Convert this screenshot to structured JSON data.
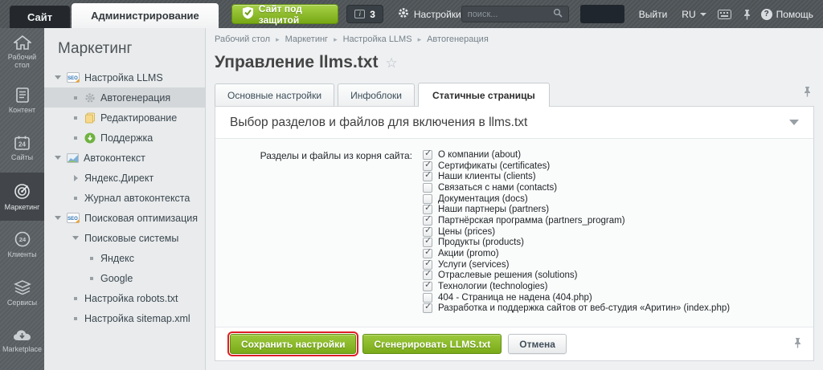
{
  "topbar": {
    "tabs": [
      {
        "label": "Сайт",
        "active": false
      },
      {
        "label": "Администрирование",
        "active": true
      }
    ],
    "protected_button": "Сайт под защитой",
    "protected_icon": "shield-check-icon",
    "notifications_count": "3",
    "notifications_icon": "info-bubble-icon",
    "settings_label": "Настройки",
    "settings_icon": "gear-icon",
    "search_placeholder": "поиск...",
    "search_icon": "magnifier-icon",
    "logout_label": "Выйти",
    "language": "RU",
    "keyboard_icon": "keyboard-icon",
    "pin_icon": "pin-icon",
    "help_label": "Помощь",
    "help_icon": "question-circle-icon"
  },
  "rail": {
    "items": [
      {
        "label": "Рабочий стол",
        "icon": "home-icon",
        "active": false
      },
      {
        "label": "Контент",
        "icon": "document-icon",
        "active": false
      },
      {
        "label": "Сайты",
        "icon": "calendar-24-icon",
        "active": false
      },
      {
        "label": "Маркетинг",
        "icon": "target-icon",
        "active": true
      },
      {
        "label": "Клиенты",
        "icon": "circle-24-icon",
        "active": false
      },
      {
        "label": "Сервисы",
        "icon": "layers-icon",
        "active": false
      },
      {
        "label": "Marketplace",
        "icon": "cloud-download-icon",
        "active": false
      }
    ]
  },
  "sidebar": {
    "title": "Маркетинг",
    "items": [
      {
        "label": "Настройка LLMS",
        "level": 0,
        "marker": "expanded",
        "icon": "seo-icon",
        "selected": false
      },
      {
        "label": "Автогенерация",
        "level": 1,
        "marker": "bullet",
        "icon": "gear-icon",
        "selected": true
      },
      {
        "label": "Редактирование",
        "level": 1,
        "marker": "bullet",
        "icon": "documents-icon",
        "selected": false
      },
      {
        "label": "Поддержка",
        "level": 1,
        "marker": "bullet",
        "icon": "update-circle-icon",
        "selected": false
      },
      {
        "label": "Автоконтекст",
        "level": 0,
        "marker": "expanded",
        "icon": "chart-icon",
        "selected": false
      },
      {
        "label": "Яндекс.Директ",
        "level": 1,
        "marker": "collapsed",
        "icon": "",
        "selected": false
      },
      {
        "label": "Журнал автоконтекста",
        "level": 1,
        "marker": "bullet",
        "icon": "",
        "selected": false
      },
      {
        "label": "Поисковая оптимизация",
        "level": 0,
        "marker": "expanded",
        "icon": "seo-icon",
        "selected": false
      },
      {
        "label": "Поисковые системы",
        "level": 1,
        "marker": "expanded",
        "icon": "",
        "selected": false
      },
      {
        "label": "Яндекс",
        "level": 2,
        "marker": "bullet",
        "icon": "",
        "selected": false
      },
      {
        "label": "Google",
        "level": 2,
        "marker": "bullet",
        "icon": "",
        "selected": false
      },
      {
        "label": "Настройка robots.txt",
        "level": 1,
        "marker": "bullet",
        "icon": "",
        "selected": false
      },
      {
        "label": "Настройка sitemap.xml",
        "level": 1,
        "marker": "bullet",
        "icon": "",
        "selected": false
      }
    ]
  },
  "breadcrumb": [
    "Рабочий стол",
    "Маркетинг",
    "Настройка LLMS",
    "Автогенерация"
  ],
  "page": {
    "title": "Управление llms.txt",
    "favorite_icon": "star-icon"
  },
  "tabs": [
    {
      "label": "Основные настройки",
      "active": false
    },
    {
      "label": "Инфоблоки",
      "active": false
    },
    {
      "label": "Статичные страницы",
      "active": true
    }
  ],
  "section": {
    "title": "Выбор разделов и файлов для включения в llms.txt",
    "collapse_icon": "chevron-down-icon"
  },
  "form": {
    "label": "Разделы и файлы из корня сайта:",
    "options": [
      {
        "label": "О компании (about)",
        "checked": true
      },
      {
        "label": "Сертификаты (certificates)",
        "checked": true
      },
      {
        "label": "Наши клиенты (clients)",
        "checked": true
      },
      {
        "label": "Связаться с нами (contacts)",
        "checked": false
      },
      {
        "label": "Документация (docs)",
        "checked": false
      },
      {
        "label": "Наши партнеры (partners)",
        "checked": true
      },
      {
        "label": "Партнёрская программа (partners_program)",
        "checked": true
      },
      {
        "label": "Цены (prices)",
        "checked": true
      },
      {
        "label": "Продукты (products)",
        "checked": true
      },
      {
        "label": "Акции (promo)",
        "checked": true
      },
      {
        "label": "Услуги (services)",
        "checked": true
      },
      {
        "label": "Отраслевые решения (solutions)",
        "checked": true
      },
      {
        "label": "Технологии (technologies)",
        "checked": true
      },
      {
        "label": "404 - Страница не надена (404.php)",
        "checked": false
      },
      {
        "label": "Разработка и поддержка сайтов от веб-студия «Аритин» (index.php)",
        "checked": true
      }
    ]
  },
  "buttons": {
    "save": "Сохранить настройки",
    "generate": "Сгенерировать LLMS.txt",
    "cancel": "Отмена"
  },
  "colors": {
    "accent_green": "#7aaa18",
    "highlight_red": "#dd1e26",
    "topbar_bg": "#51565a",
    "sidebar_bg": "#e9ebec"
  }
}
